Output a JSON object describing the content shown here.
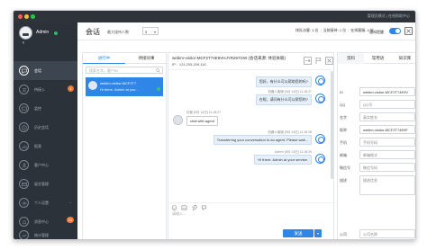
{
  "titlebar": {
    "links": "管理员模式 | 在线帮助中心"
  },
  "sidebar": {
    "user_name": "Admin",
    "back_glyph": "‹",
    "items": [
      {
        "label": "会话",
        "icon": "chat-icon",
        "badge": ""
      },
      {
        "label": "待接入",
        "icon": "queue-icon",
        "badge": "1"
      },
      {
        "label": "监控",
        "icon": "monitor-icon",
        "badge": ""
      },
      {
        "label": "历史会话",
        "icon": "history-icon",
        "badge": ""
      },
      {
        "label": "报表",
        "icon": "report-icon",
        "badge": ""
      },
      {
        "label": "客户中心",
        "icon": "customer-icon",
        "badge": ""
      },
      {
        "label": "留言管理",
        "icon": "message-icon",
        "badge": ""
      },
      {
        "label": "个人设置",
        "icon": "settings-icon",
        "badge": ""
      },
      {
        "label": "消息中心",
        "icon": "bell-icon",
        "badge": "23"
      },
      {
        "label": "统计管理",
        "icon": "stats-icon",
        "badge": ""
      }
    ]
  },
  "topbar": {
    "title": "会话",
    "max_label": "最大接待人数",
    "max_value": "3",
    "status_parts": [
      "排队访客: 1 位",
      "当前接待: 1 位",
      "在线客服: 4 位"
    ],
    "toggle_label": "通知提醒",
    "toggle_on": true
  },
  "list": {
    "tabs": [
      "进行中",
      "待接同事"
    ],
    "search_placeholder": "搜索名字，客户ID",
    "visitor_name": "webim-visitor-MCF2T7",
    "visitor_msg": "Hi there. Admin at you..."
  },
  "chat": {
    "title": "webim-visitor-MCF2T74E9VHJYR267GW (会话来源: 体验关联)",
    "ip_label": "IP:",
    "ip_value": "124.205.209.116",
    "messages": [
      {
        "side": "right",
        "meta": "",
        "text": "您好，有什么可以帮助您的吗?"
      },
      {
        "side": "right",
        "meta": "机器人客服 [9月 14日] 11:18:27",
        "text": "在呢，请问有什么可以帮您的?"
      },
      {
        "side": "left",
        "meta": "访客 [9月 14日] 11:18:27",
        "text": "chat with agent"
      },
      {
        "side": "right",
        "meta": "机器人客服 [9月 14日] 11:18:28",
        "text": "Transferring your conversation to an agent. Please wait..."
      },
      {
        "side": "right",
        "meta": "Admin [9月 14日] 11:18:29",
        "text": "Hi there. Admin at your service."
      }
    ],
    "input_placeholder": "请输入...",
    "send_label": "发送",
    "send_arrow": "▾"
  },
  "detail": {
    "tabs": [
      "资料",
      "常用语",
      "知识库"
    ],
    "fields": [
      {
        "label": "ID",
        "value": "webim-visitor-MCF2T74E9V",
        "filled": true
      },
      {
        "label": "QQ",
        "value": "QQ号",
        "filled": false
      },
      {
        "label": "名字",
        "value": "真实姓名",
        "filled": false
      },
      {
        "label": "昵称",
        "value": "webim-visitor-MCF2T74E9F",
        "filled": true
      },
      {
        "label": "手机",
        "value": "手机号码",
        "filled": false
      },
      {
        "label": "邮箱",
        "value": "邮箱格式",
        "filled": false
      },
      {
        "label": "微信号",
        "value": "微信号码",
        "filled": false
      },
      {
        "label": "描述",
        "value": "描述信息",
        "filled": false
      }
    ],
    "company_label": "公司",
    "company_placeholder": "公司名称"
  }
}
